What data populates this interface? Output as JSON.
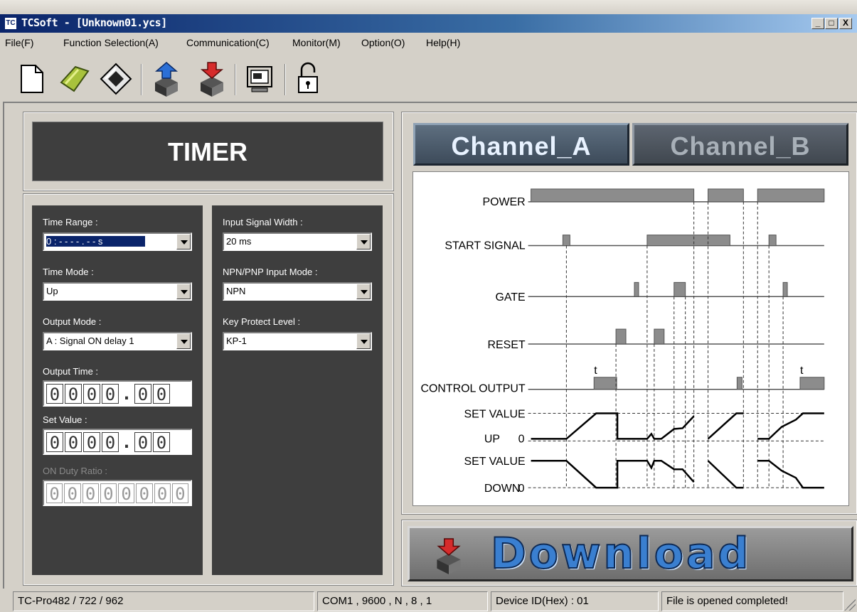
{
  "window": {
    "title": "TCSoft  - [Unknown01.ycs]",
    "app_icon": "TC",
    "controls": [
      "_",
      "□",
      "X"
    ]
  },
  "menu": [
    "File(F)",
    "Function Selection(A)",
    "Communication(C)",
    "Monitor(M)",
    "Option(O)",
    "Help(H)"
  ],
  "toolbar": [
    "new-file-icon",
    "open-folder-icon",
    "save-disk-icon",
    "upload-device-icon",
    "download-device-icon",
    "monitor-icon",
    "lock-icon"
  ],
  "header": {
    "title": "TIMER"
  },
  "left": {
    "time_range_label": "Time Range :",
    "time_range_value": "0 : - - - - . - -  s",
    "time_mode_label": "Time Mode :",
    "time_mode_value": "Up",
    "output_mode_label": "Output Mode :",
    "output_mode_value": "A : Signal ON delay 1",
    "output_time_label": "Output Time :",
    "output_time_digits": [
      "0",
      "0",
      "0",
      "0",
      ".",
      "0",
      "0"
    ],
    "set_value_label": "Set Value :",
    "set_value_digits": [
      "0",
      "0",
      "0",
      "0",
      ".",
      "0",
      "0"
    ],
    "on_duty_label": "ON Duty Ratio :",
    "on_duty_digits": [
      "0",
      "0",
      "0",
      "0",
      "0",
      "0",
      "0",
      "0"
    ]
  },
  "middle": {
    "input_width_label": "Input Signal Width :",
    "input_width_value": "20 ms",
    "npn_label": "NPN/PNP Input Mode :",
    "npn_value": "NPN",
    "key_label": "Key Protect Level :",
    "key_value": "KP-1"
  },
  "channels": {
    "a": "Channel_A",
    "b": "Channel_B"
  },
  "diagram": {
    "labels": {
      "power": "POWER",
      "start": "START  SIGNAL",
      "gate": "GATE",
      "reset": "RESET",
      "control": "CONTROL  OUTPUT",
      "set_value_up": "SET  VALUE",
      "up": "UP",
      "up_zero": "0",
      "set_value_down": "SET  VALUE",
      "down": "DOWN",
      "down_zero": "0",
      "t1": "t",
      "t2": "t"
    }
  },
  "download": {
    "label": "Download"
  },
  "status": {
    "model": "TC-Pro482 / 722 / 962",
    "port": "COM1 , 9600 , N , 8 , 1",
    "device": "Device ID(Hex) : 01",
    "message": "File is opened completed!"
  }
}
